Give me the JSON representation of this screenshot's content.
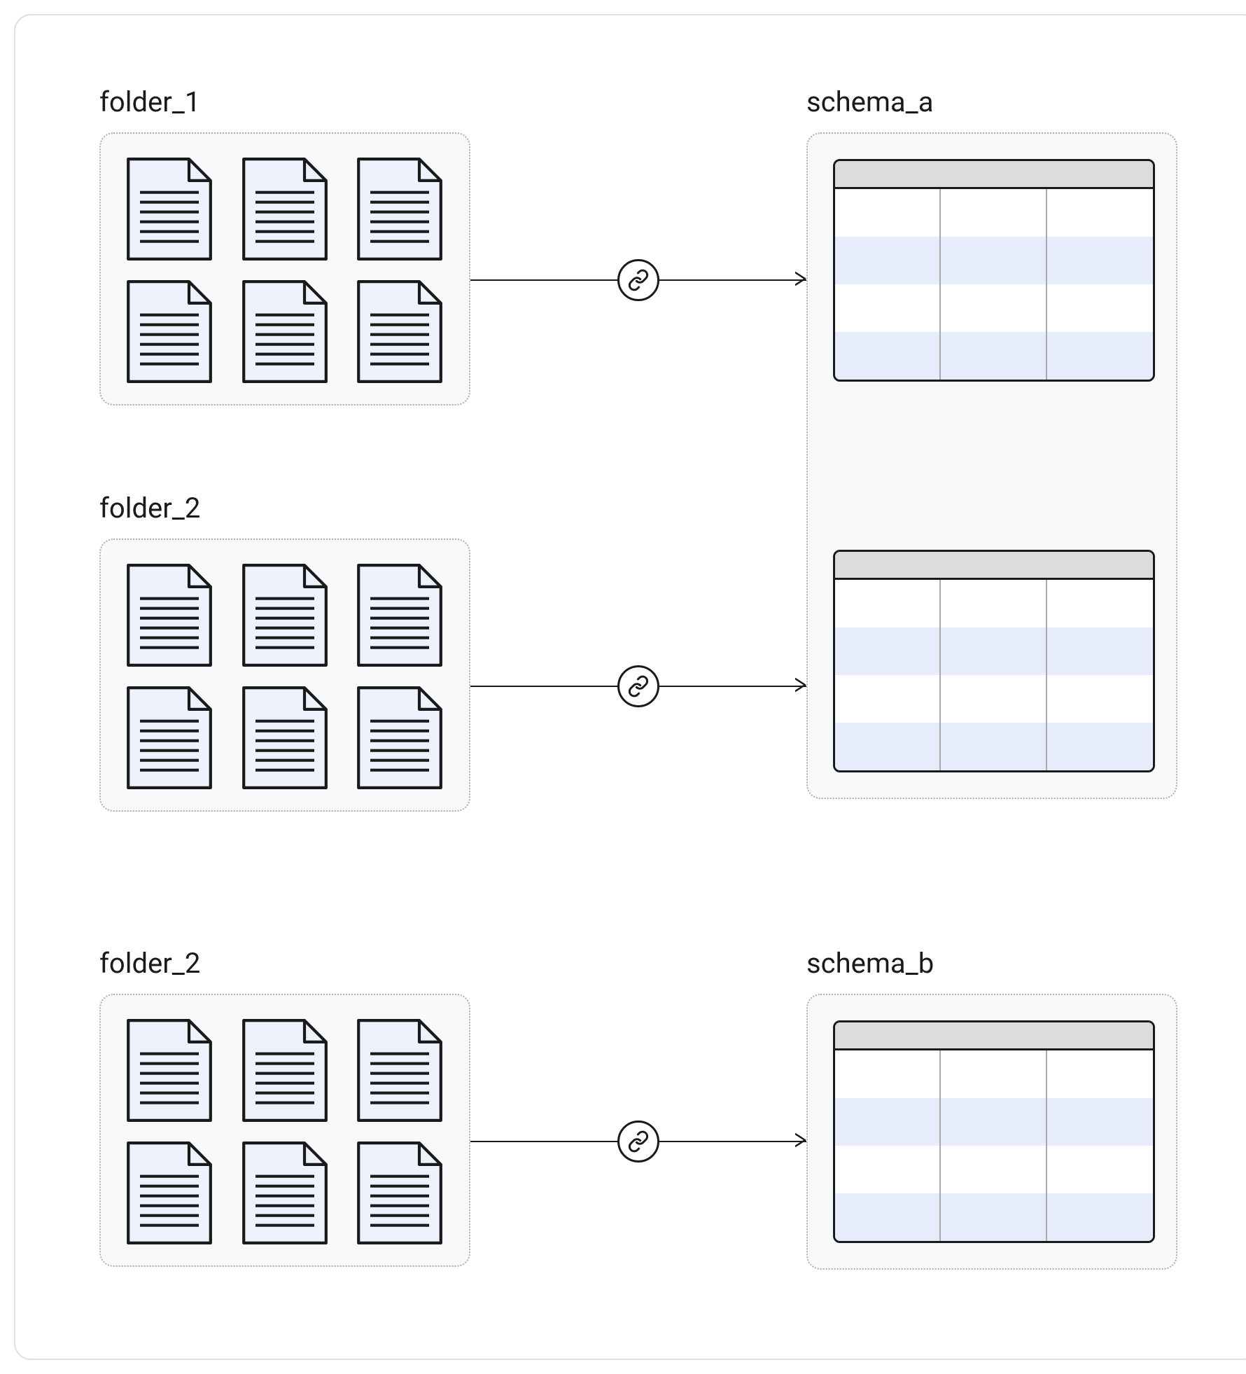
{
  "folders": [
    {
      "label": "folder_1",
      "documents": 6
    },
    {
      "label": "folder_2",
      "documents": 6
    },
    {
      "label": "folder_2",
      "documents": 6
    }
  ],
  "schemas": [
    {
      "label": "schema_a",
      "tables": 2
    },
    {
      "label": "schema_b",
      "tables": 1
    }
  ],
  "mappings": [
    {
      "from": "folder_1",
      "to": "schema_a",
      "to_table_index": 0
    },
    {
      "from": "folder_2",
      "to": "schema_a",
      "to_table_index": 1
    },
    {
      "from": "folder_2",
      "to": "schema_b",
      "to_table_index": 0
    }
  ],
  "table_structure": {
    "columns": 3,
    "rows": 4,
    "row_colors": [
      "white",
      "blue",
      "white",
      "blue"
    ],
    "header_color": "#dcdcdc"
  },
  "icons": {
    "link": "link-icon",
    "document": "document-icon"
  }
}
